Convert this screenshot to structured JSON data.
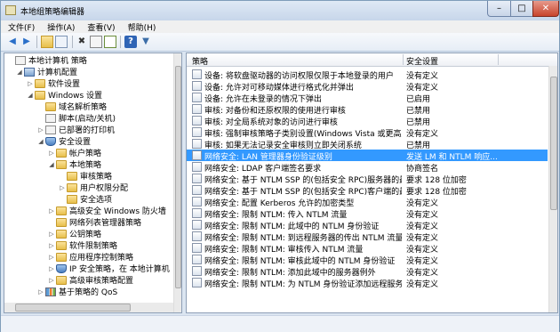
{
  "window": {
    "title": "本地组策略编辑器",
    "minimize_glyph": "–",
    "maximize_glyph": "□",
    "close_glyph": "✕"
  },
  "menu": [
    "文件(F)",
    "操作(A)",
    "查看(V)",
    "帮助(H)"
  ],
  "toolbar_icons": [
    "back-arrow-icon",
    "forward-arrow-icon",
    "up-folder-icon",
    "show-tree-icon",
    "delete-icon",
    "properties-icon",
    "export-list-icon",
    "help-icon",
    "filter-icon"
  ],
  "tree": [
    {
      "label": "本地计算机 策略",
      "icon": "computer-policy-icon",
      "expand": ""
    },
    {
      "label": "计算机配置",
      "icon": "computer-icon",
      "expand": "◢"
    },
    {
      "label": "软件设置",
      "icon": "folder-icon",
      "expand": "▷"
    },
    {
      "label": "Windows 设置",
      "icon": "folder-icon",
      "expand": "◢"
    },
    {
      "label": "域名解析策略",
      "icon": "folder-icon",
      "expand": ""
    },
    {
      "label": "脚本(启动/关机)",
      "icon": "document-icon",
      "expand": ""
    },
    {
      "label": "已部署的打印机",
      "icon": "printer-icon",
      "expand": "▷"
    },
    {
      "label": "安全设置",
      "icon": "security-icon",
      "expand": "◢"
    },
    {
      "label": "帐户策略",
      "icon": "folder-icon",
      "expand": "▷"
    },
    {
      "label": "本地策略",
      "icon": "folder-icon",
      "expand": "◢"
    },
    {
      "label": "审核策略",
      "icon": "folder-icon",
      "expand": ""
    },
    {
      "label": "用户权限分配",
      "icon": "folder-icon",
      "expand": "▷"
    },
    {
      "label": "安全选项",
      "icon": "folder-open-icon",
      "expand": ""
    },
    {
      "label": "高级安全 Windows 防火墙",
      "icon": "folder-icon",
      "expand": "▷"
    },
    {
      "label": "网络列表管理器策略",
      "icon": "folder-icon",
      "expand": ""
    },
    {
      "label": "公钥策略",
      "icon": "folder-icon",
      "expand": "▷"
    },
    {
      "label": "软件限制策略",
      "icon": "folder-icon",
      "expand": "▷"
    },
    {
      "label": "应用程序控制策略",
      "icon": "folder-icon",
      "expand": "▷"
    },
    {
      "label": "IP 安全策略，在 本地计算机",
      "icon": "ip-security-icon",
      "expand": "▷"
    },
    {
      "label": "高级审核策略配置",
      "icon": "folder-icon",
      "expand": "▷"
    },
    {
      "label": "基于策略的 QoS",
      "icon": "qos-chart-icon",
      "expand": "▷"
    }
  ],
  "list": {
    "col_policy": "策略",
    "col_setting": "安全设置",
    "rows": [
      {
        "name": "设备: 将软盘驱动器的访问权限仅限于本地登录的用户",
        "value": "没有定义"
      },
      {
        "name": "设备: 允许对可移动媒体进行格式化并弹出",
        "value": "没有定义"
      },
      {
        "name": "设备: 允许在未登录的情况下弹出",
        "value": "已启用"
      },
      {
        "name": "审核: 对备份和还原权限的使用进行审核",
        "value": "已禁用"
      },
      {
        "name": "审核: 对全局系统对象的访问进行审核",
        "value": "已禁用"
      },
      {
        "name": "审核: 强制审核策略子类别设置(Windows Vista 或更高版本...",
        "value": "没有定义"
      },
      {
        "name": "审核: 如果无法记录安全审核则立即关闭系统",
        "value": "已禁用"
      },
      {
        "name": "网络安全: LAN 管理器身份验证级别",
        "value": "发送 LM 和 NTLM 响应..."
      },
      {
        "name": "网络安全: LDAP 客户端签名要求",
        "value": "协商签名"
      },
      {
        "name": "网络安全: 基于 NTLM SSP 的(包括安全 RPC)服务器的最小...",
        "value": "要求 128 位加密"
      },
      {
        "name": "网络安全: 基于 NTLM SSP 的(包括安全 RPC)客户端的最小...",
        "value": "要求 128 位加密"
      },
      {
        "name": "网络安全: 配置 Kerberos 允许的加密类型",
        "value": "没有定义"
      },
      {
        "name": "网络安全: 限制 NTLM: 传入 NTLM 流量",
        "value": "没有定义"
      },
      {
        "name": "网络安全: 限制 NTLM: 此域中的 NTLM 身份验证",
        "value": "没有定义"
      },
      {
        "name": "网络安全: 限制 NTLM: 到远程服务器的传出 NTLM 流量",
        "value": "没有定义"
      },
      {
        "name": "网络安全: 限制 NTLM: 审核传入 NTLM 流量",
        "value": "没有定义"
      },
      {
        "name": "网络安全: 限制 NTLM: 审核此域中的 NTLM 身份验证",
        "value": "没有定义"
      },
      {
        "name": "网络安全: 限制 NTLM: 添加此域中的服务器例外",
        "value": "没有定义"
      },
      {
        "name": "网络安全: 限制 NTLM: 为 NTLM 身份验证添加远程服务器...",
        "value": "没有定义"
      }
    ]
  }
}
